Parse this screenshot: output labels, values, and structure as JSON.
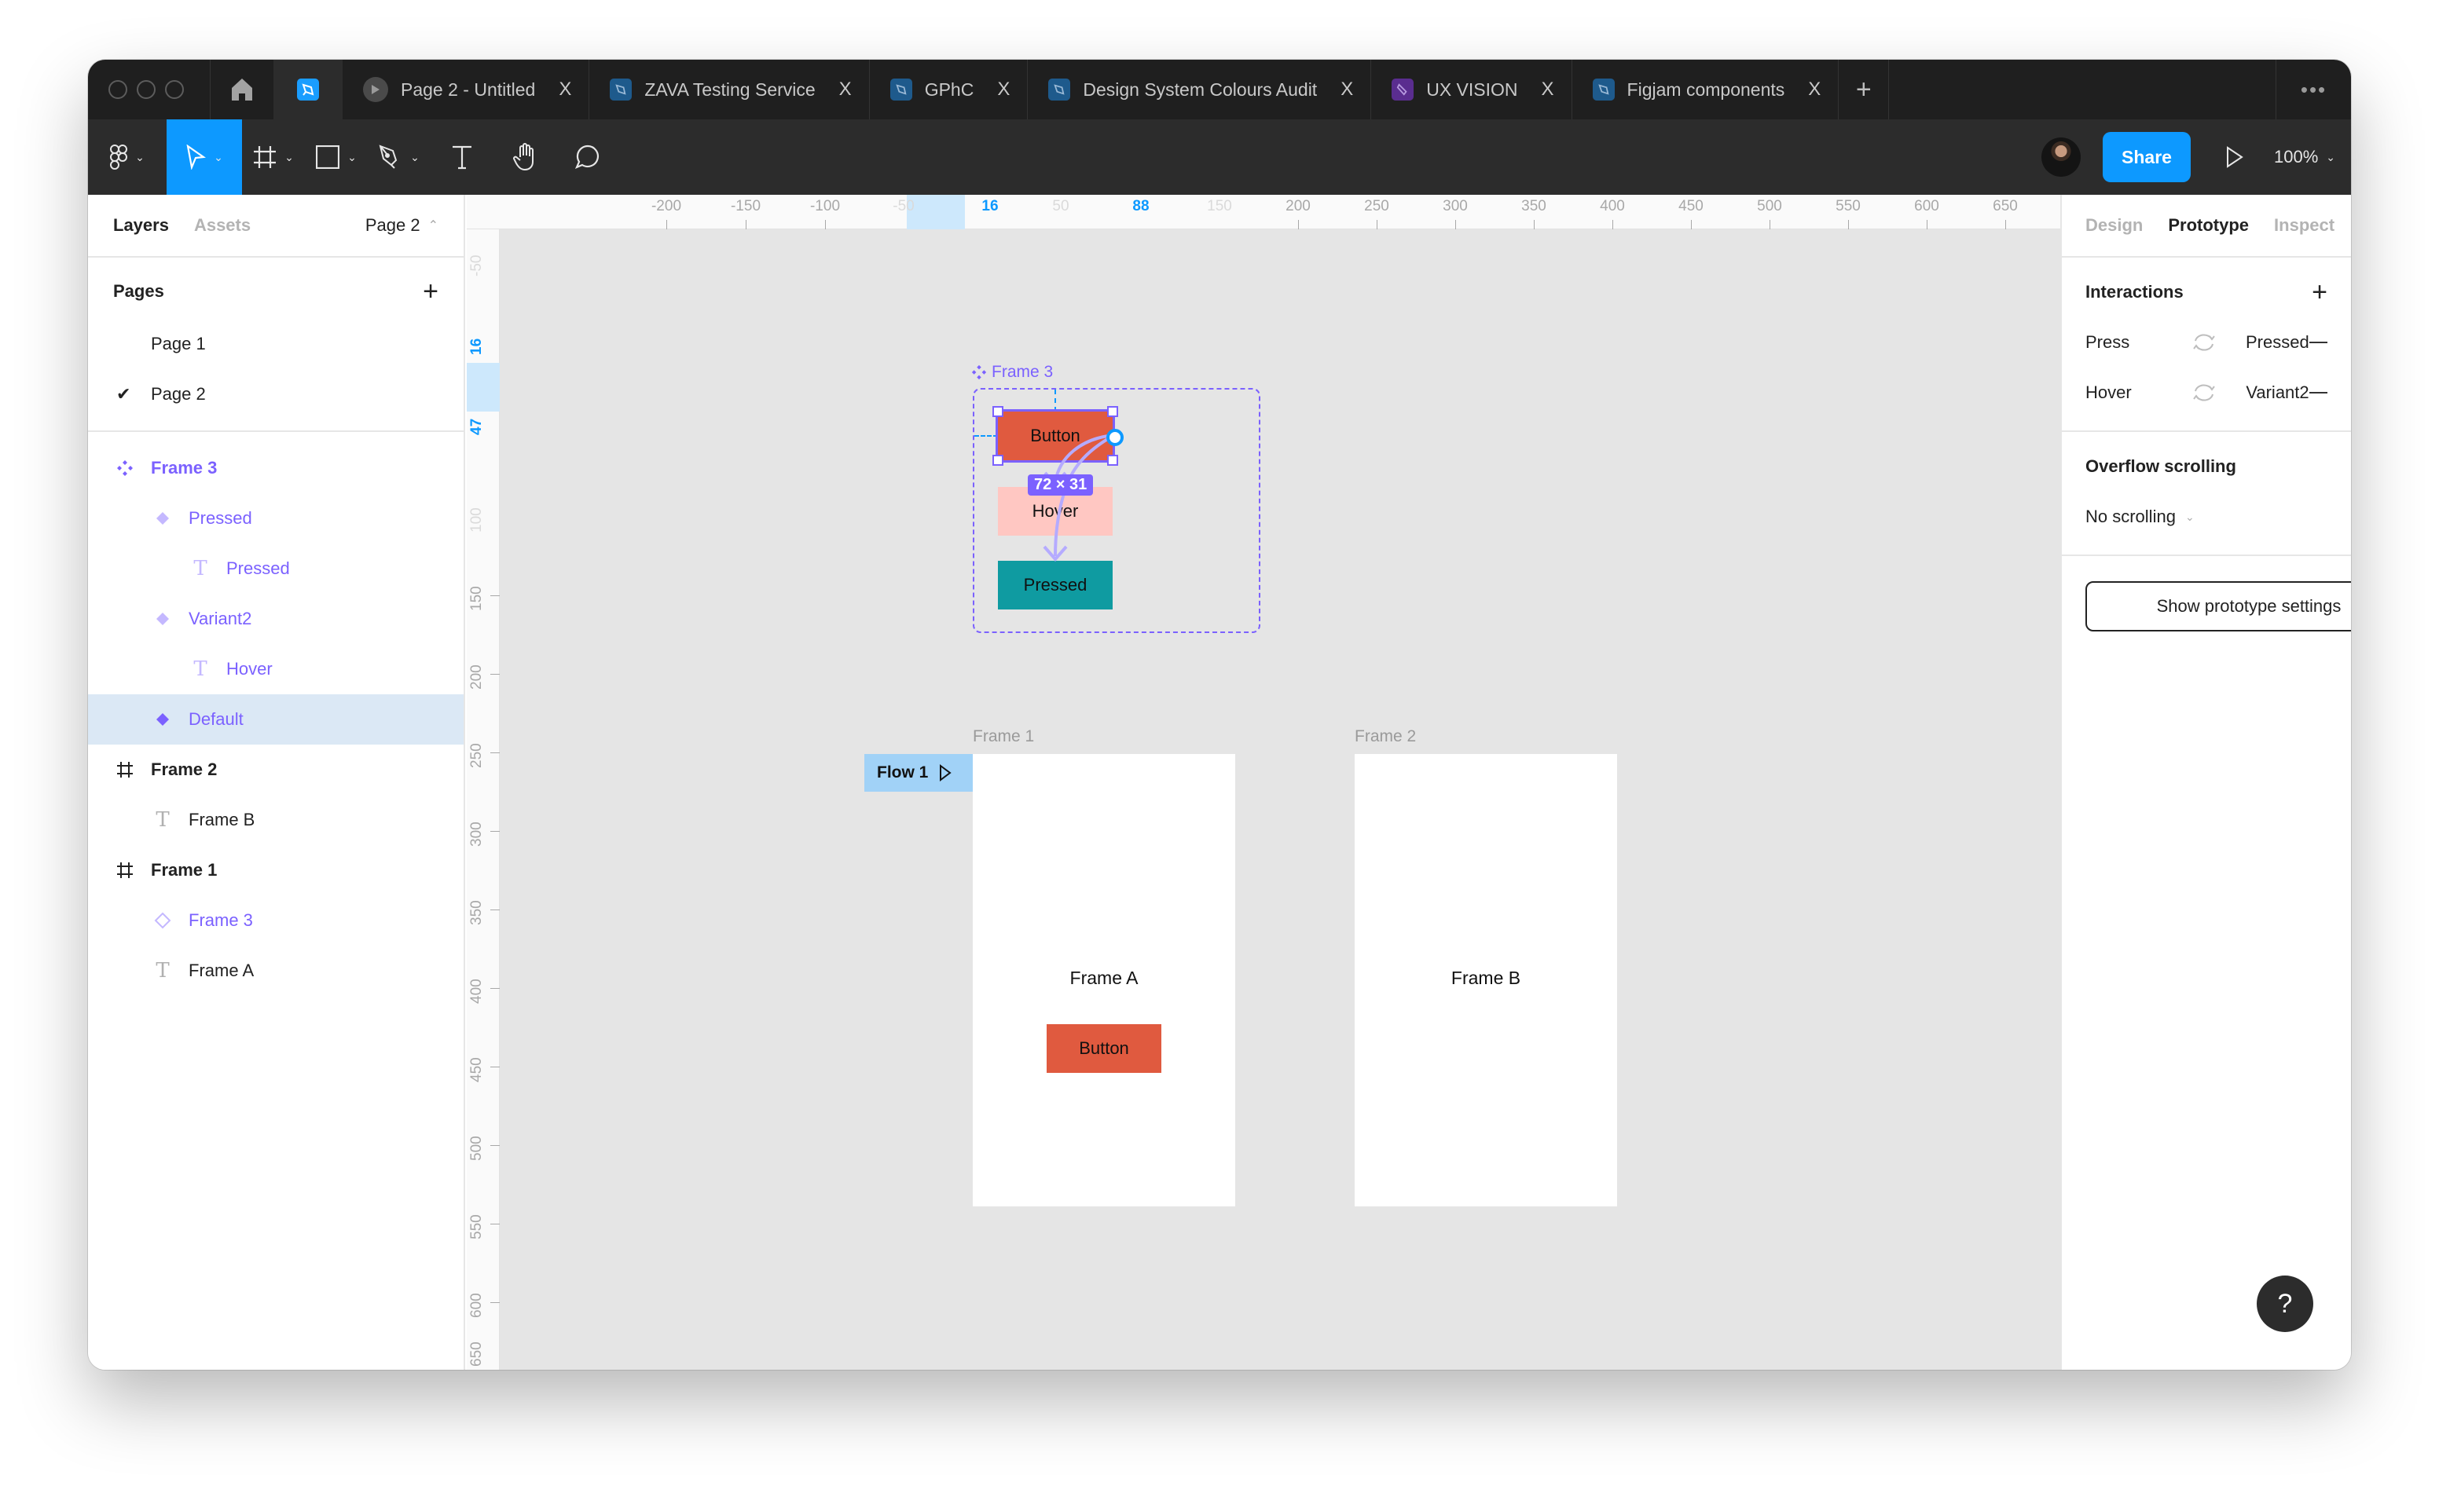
{
  "window": {
    "tabs": [
      {
        "label": "Page 2 - Untitled",
        "icon": "play-icon"
      },
      {
        "label": "ZAVA Testing Service",
        "icon": "figma-file-icon"
      },
      {
        "label": "GPhC",
        "icon": "figma-file-icon"
      },
      {
        "label": "Design System Colours Audit",
        "icon": "figma-file-icon"
      },
      {
        "label": "UX VISION",
        "icon": "figjam-file-icon"
      },
      {
        "label": "Figjam components",
        "icon": "figma-file-icon"
      }
    ],
    "close_glyph": "X",
    "new_tab_glyph": "+",
    "more_glyph": "•••"
  },
  "toolbar": {
    "share_label": "Share",
    "zoom_level": "100%",
    "tools": [
      "main-menu",
      "move",
      "frame",
      "shape",
      "pen",
      "text",
      "hand",
      "comment"
    ],
    "active_tool": "move",
    "accent_color": "#0d99ff"
  },
  "left_panel": {
    "tab_layers": "Layers",
    "tab_assets": "Assets",
    "current_page": "Page 2",
    "pages_header": "Pages",
    "pages": [
      {
        "label": "Page 1",
        "selected": false
      },
      {
        "label": "Page 2",
        "selected": true
      }
    ],
    "layers": [
      {
        "label": "Frame 3",
        "type": "component-set",
        "depth": 0
      },
      {
        "label": "Pressed",
        "type": "variant",
        "depth": 1
      },
      {
        "label": "Pressed",
        "type": "text",
        "depth": 2
      },
      {
        "label": "Variant2",
        "type": "variant",
        "depth": 1
      },
      {
        "label": "Hover",
        "type": "text",
        "depth": 2
      },
      {
        "label": "Default",
        "type": "variant",
        "depth": 1,
        "selected": true
      },
      {
        "label": "Frame 2",
        "type": "frame",
        "depth": 0
      },
      {
        "label": "Frame B",
        "type": "text",
        "depth": 1
      },
      {
        "label": "Frame 1",
        "type": "frame",
        "depth": 0
      },
      {
        "label": "Frame 3",
        "type": "instance",
        "depth": 1
      },
      {
        "label": "Frame A",
        "type": "text",
        "depth": 1
      }
    ]
  },
  "rulers": {
    "top": [
      "-200",
      "-150",
      "-100",
      "-50",
      "16",
      "50",
      "88",
      "150",
      "200",
      "250",
      "300",
      "350",
      "400",
      "450",
      "500",
      "550",
      "600",
      "650"
    ],
    "top_selection": [
      "16",
      "88"
    ],
    "left": [
      "-50",
      "16",
      "47",
      "100",
      "150",
      "200",
      "250",
      "300",
      "350",
      "400",
      "450",
      "500",
      "550",
      "600",
      "650"
    ],
    "left_selection": [
      "16",
      "47"
    ]
  },
  "canvas": {
    "component_set": {
      "label": "Frame 3",
      "variants": [
        {
          "label": "Button",
          "color": "#e05a3f"
        },
        {
          "label": "Hover",
          "color": "#ffc7c2"
        },
        {
          "label": "Pressed",
          "color": "#0f9ba1"
        }
      ],
      "selection_dims": "72 × 31"
    },
    "frames": [
      {
        "label": "Frame 1",
        "text": "Frame A",
        "button_label": "Button"
      },
      {
        "label": "Frame 2",
        "text": "Frame B"
      }
    ],
    "flow_label": "Flow 1",
    "help_glyph": "?"
  },
  "right_panel": {
    "tabs": [
      {
        "label": "Design",
        "active": false
      },
      {
        "label": "Prototype",
        "active": true
      },
      {
        "label": "Inspect",
        "active": false
      }
    ],
    "interactions_header": "Interactions",
    "interactions": [
      {
        "trigger": "Press",
        "action": "change-to",
        "destination": "Pressed"
      },
      {
        "trigger": "Hover",
        "action": "change-to",
        "destination": "Variant2"
      }
    ],
    "overflow_header": "Overflow scrolling",
    "overflow_value": "No scrolling",
    "prototype_settings_button": "Show prototype settings"
  }
}
